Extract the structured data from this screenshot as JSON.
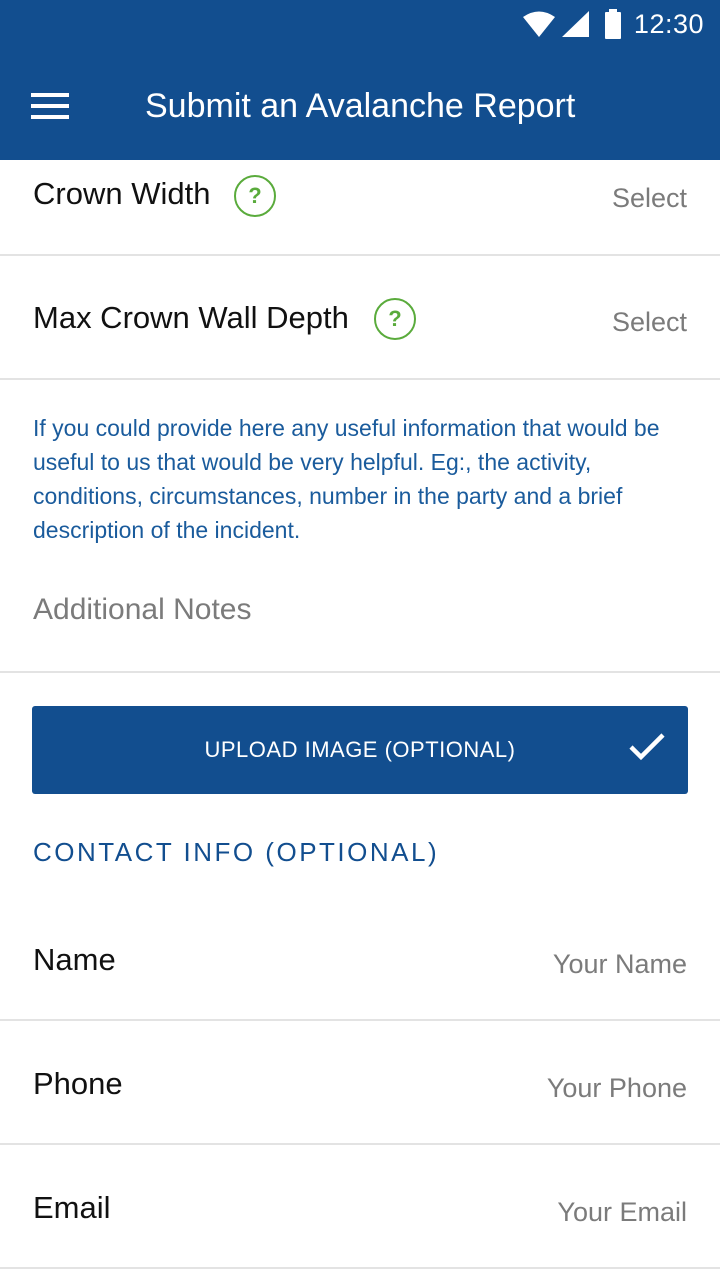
{
  "status_bar": {
    "time": "12:30",
    "icons": [
      "wifi-icon",
      "cell-signal-icon",
      "battery-icon"
    ]
  },
  "app_bar": {
    "title": "Submit an Avalanche Report",
    "menu_icon": "hamburger-menu-icon"
  },
  "fields": {
    "crown_width": {
      "label": "Crown Width",
      "value": "Select",
      "help": "?"
    },
    "max_crown_wall_depth": {
      "label": "Max Crown Wall Depth",
      "value": "Select",
      "help": "?"
    }
  },
  "info_text": "If you could provide here any useful information that would be useful to us that would be very helpful. Eg:, the activity, conditions, circumstances, number in the party and a brief description of the incident.",
  "notes": {
    "placeholder": "Additional Notes"
  },
  "upload": {
    "label": "UPLOAD IMAGE (OPTIONAL)",
    "icon": "check-icon"
  },
  "contact": {
    "heading": "CONTACT INFO (OPTIONAL)",
    "name": {
      "label": "Name",
      "placeholder": "Your Name"
    },
    "phone": {
      "label": "Phone",
      "placeholder": "Your Phone"
    },
    "email": {
      "label": "Email",
      "placeholder": "Your Email"
    }
  },
  "colors": {
    "primary": "#124e8f",
    "info_text": "#1a5b9c",
    "help_icon": "#5aab3c",
    "placeholder": "#7b7b7b",
    "divider": "#e3e3e3"
  }
}
